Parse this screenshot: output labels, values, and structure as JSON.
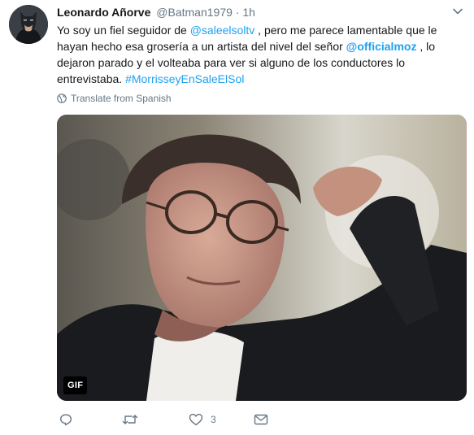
{
  "tweet": {
    "author_name": "Leonardo Añorve",
    "handle": "@Batman1979",
    "separator": "·",
    "time": "1h",
    "text": {
      "part1": "Yo soy un fiel seguidor de ",
      "mention1": "@saleelsoltv",
      "part2": " , pero me parece lamentable que le hayan hecho esa grosería a un artista del nivel del señor ",
      "mention2": "@officialmoz",
      "part3": " , lo dejaron parado y el volteaba para ver si alguno de los conductores lo entrevistaba. ",
      "hashtag": "#MorrisseyEnSaleElSol"
    },
    "translate_label": "Translate from Spanish",
    "media": {
      "badge": "GIF"
    },
    "actions": {
      "reply_count": "",
      "retweet_count": "",
      "like_count": "3"
    }
  },
  "icons": {
    "avatar": "batman-avatar",
    "menu": "chevron-down-icon",
    "translate": "globe-icon",
    "reply": "reply-icon",
    "retweet": "retweet-icon",
    "like": "heart-icon",
    "dm": "envelope-icon"
  },
  "colors": {
    "link": "#1da1f2",
    "muted": "#657786",
    "text": "#14171a"
  }
}
